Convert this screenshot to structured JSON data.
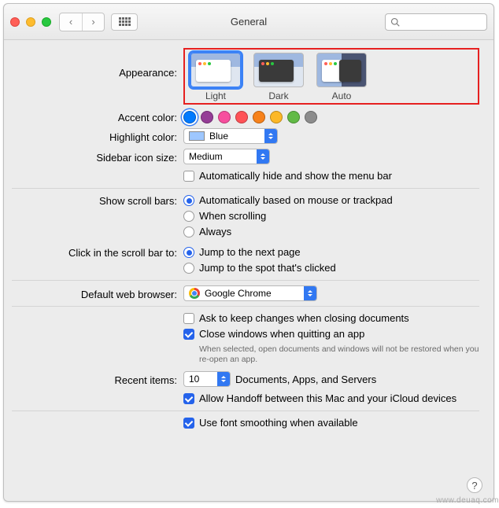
{
  "window": {
    "title": "General"
  },
  "search": {
    "placeholder": ""
  },
  "labels": {
    "appearance": "Appearance:",
    "accent": "Accent color:",
    "highlight": "Highlight color:",
    "sidebar_icon": "Sidebar icon size:",
    "scrollbars": "Show scroll bars:",
    "scroll_click": "Click in the scroll bar to:",
    "default_browser": "Default web browser:",
    "recent_items": "Recent items:"
  },
  "appearance": {
    "options": [
      {
        "key": "light",
        "label": "Light",
        "selected": true
      },
      {
        "key": "dark",
        "label": "Dark",
        "selected": false
      },
      {
        "key": "auto",
        "label": "Auto",
        "selected": false
      }
    ]
  },
  "accent_colors": [
    {
      "name": "blue",
      "hex": "#007aff",
      "selected": true
    },
    {
      "name": "purple",
      "hex": "#953d96",
      "selected": false
    },
    {
      "name": "pink",
      "hex": "#f74f9e",
      "selected": false
    },
    {
      "name": "red",
      "hex": "#ff5257",
      "selected": false
    },
    {
      "name": "orange",
      "hex": "#f7821b",
      "selected": false
    },
    {
      "name": "yellow",
      "hex": "#fcb827",
      "selected": false
    },
    {
      "name": "green",
      "hex": "#62ba46",
      "selected": false
    },
    {
      "name": "graphite",
      "hex": "#8c8c8c",
      "selected": false
    }
  ],
  "highlight": {
    "value": "Blue"
  },
  "sidebar_icon": {
    "value": "Medium"
  },
  "menubar_autohide": {
    "label": "Automatically hide and show the menu bar",
    "checked": false
  },
  "scrollbars": {
    "options": [
      {
        "label": "Automatically based on mouse or trackpad",
        "checked": true
      },
      {
        "label": "When scrolling",
        "checked": false
      },
      {
        "label": "Always",
        "checked": false
      }
    ]
  },
  "scroll_click": {
    "options": [
      {
        "label": "Jump to the next page",
        "checked": true
      },
      {
        "label": "Jump to the spot that's clicked",
        "checked": false
      }
    ]
  },
  "default_browser": {
    "value": "Google Chrome"
  },
  "documents": {
    "ask_keep": {
      "label": "Ask to keep changes when closing documents",
      "checked": false
    },
    "close_windows": {
      "label": "Close windows when quitting an app",
      "checked": true
    },
    "close_windows_hint": "When selected, open documents and windows will not be restored when you re-open an app."
  },
  "recent_items": {
    "value": "10",
    "suffix": "Documents, Apps, and Servers"
  },
  "handoff": {
    "label": "Allow Handoff between this Mac and your iCloud devices",
    "checked": true
  },
  "font_smoothing": {
    "label": "Use font smoothing when available",
    "checked": true
  },
  "watermark": "www.deuaq.com"
}
